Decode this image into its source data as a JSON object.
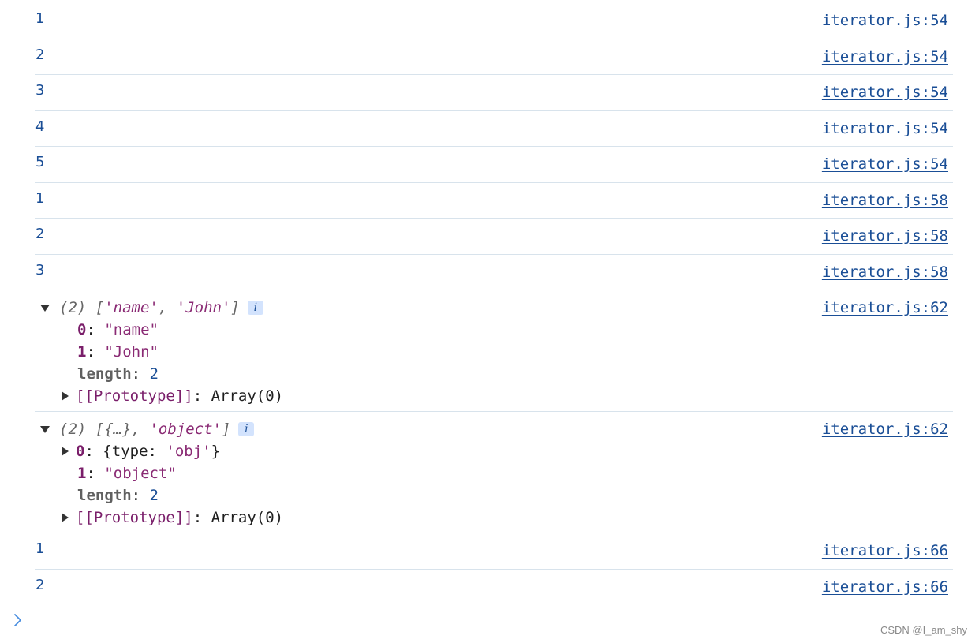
{
  "simple_rows": [
    {
      "value": "1",
      "source": "iterator.js:54"
    },
    {
      "value": "2",
      "source": "iterator.js:54"
    },
    {
      "value": "3",
      "source": "iterator.js:54"
    },
    {
      "value": "4",
      "source": "iterator.js:54"
    },
    {
      "value": "5",
      "source": "iterator.js:54"
    },
    {
      "value": "1",
      "source": "iterator.js:58"
    },
    {
      "value": "2",
      "source": "iterator.js:58"
    },
    {
      "value": "3",
      "source": "iterator.js:58"
    }
  ],
  "array_rows": [
    {
      "source": "iterator.js:62",
      "count": "(2)",
      "preview_open": "[",
      "preview_item1": "'name'",
      "preview_sep": ", ",
      "preview_item2": "'John'",
      "preview_close": "]",
      "info": "i",
      "props": [
        {
          "key": "0",
          "sep": ": ",
          "value": "\"name\""
        },
        {
          "key": "1",
          "sep": ": ",
          "value": "\"John\""
        },
        {
          "key": "length",
          "sep": ": ",
          "value": "2"
        },
        {
          "key": "[[Prototype]]",
          "sep": ": ",
          "value": "Array(0)"
        }
      ]
    },
    {
      "source": "iterator.js:62",
      "count": "(2)",
      "preview_open": "[",
      "preview_item1": "{…}",
      "preview_sep": ", ",
      "preview_item2": "'object'",
      "preview_close": "]",
      "info": "i",
      "props": [
        {
          "key": "0",
          "sep": ": ",
          "value_open": "{type: ",
          "value_str": "'obj'",
          "value_close": "}"
        },
        {
          "key": "1",
          "sep": ": ",
          "value": "\"object\""
        },
        {
          "key": "length",
          "sep": ": ",
          "value": "2"
        },
        {
          "key": "[[Prototype]]",
          "sep": ": ",
          "value": "Array(0)"
        }
      ]
    }
  ],
  "tail_rows": [
    {
      "value": "1",
      "source": "iterator.js:66"
    },
    {
      "value": "2",
      "source": "iterator.js:66"
    }
  ],
  "prompt_icon": "chevron-right-icon",
  "watermark": "CSDN @I_am_shy",
  "colors": {
    "link": "#1a4e96",
    "string": "#8a2a74",
    "key": "#7a1e6a",
    "separator": "#d8e3ec",
    "info_badge_bg": "#d3e3fd"
  }
}
